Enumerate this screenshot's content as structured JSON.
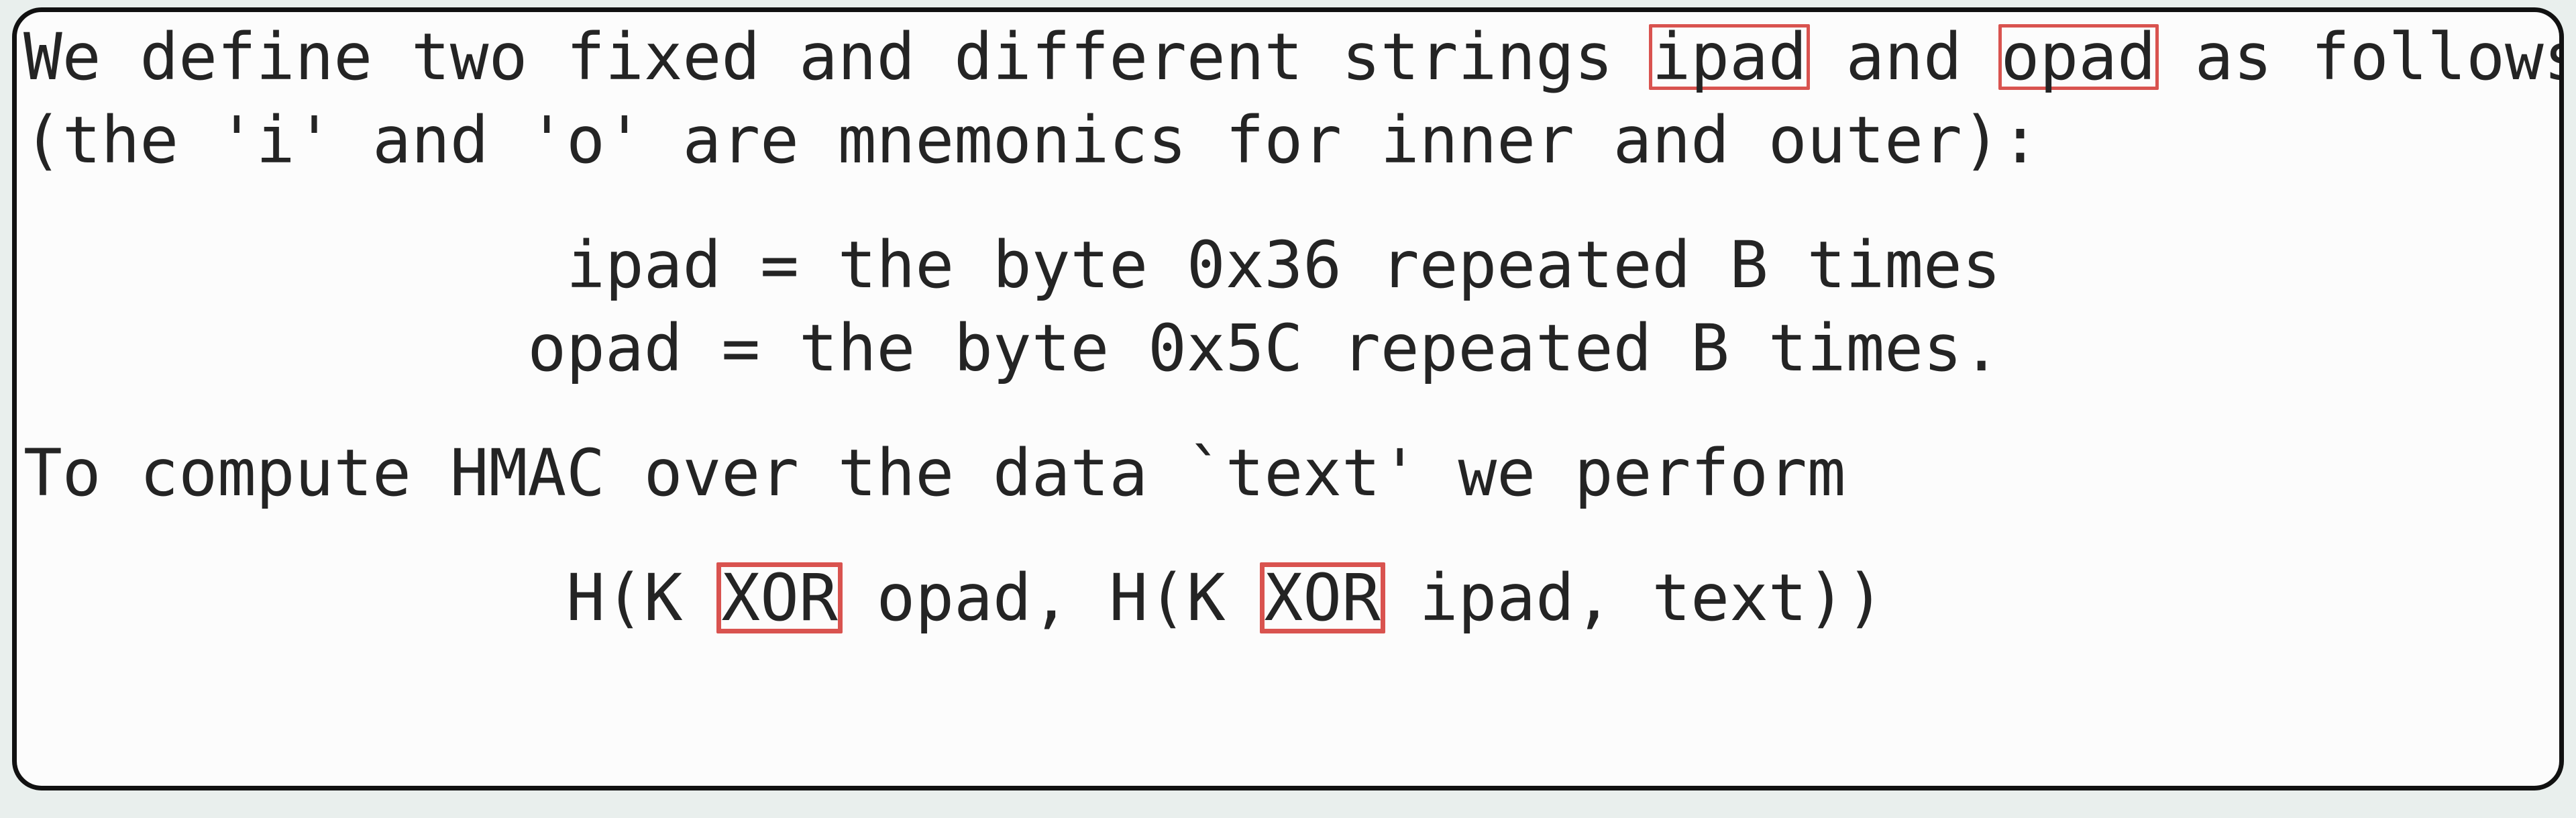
{
  "document": {
    "kind": "rfc-excerpt-card",
    "background_color": "#e9efed",
    "card_background_color": "#fcfcfc",
    "card_border_color": "#111111",
    "text_color": "#242424",
    "highlight_color": "#d9534f",
    "lines": [
      {
        "id": "line-1",
        "segments": [
          {
            "text": "We define two fixed and different strings "
          },
          {
            "text": "ipad",
            "highlighted": true
          },
          {
            "text": " and "
          },
          {
            "text": "opad",
            "highlighted": true
          },
          {
            "text": " as follows"
          }
        ]
      },
      {
        "id": "line-2",
        "segments": [
          {
            "text": "(the 'i' and 'o' are mnemonics for inner and outer):"
          }
        ]
      },
      {
        "id": "line-3-blank",
        "blank": true,
        "segments": []
      },
      {
        "id": "line-4",
        "segments": [
          {
            "text": "              ipad = the byte 0x36 repeated B times"
          }
        ]
      },
      {
        "id": "line-5",
        "segments": [
          {
            "text": "             opad = the byte 0x5C repeated B times."
          }
        ]
      },
      {
        "id": "line-6-blank",
        "blank": true,
        "segments": []
      },
      {
        "id": "line-7",
        "segments": [
          {
            "text": "To compute HMAC over the data `text' we perform"
          }
        ]
      },
      {
        "id": "line-8-blank",
        "blank": true,
        "segments": []
      },
      {
        "id": "line-9",
        "segments": [
          {
            "text": "              H(K "
          },
          {
            "text": "XOR",
            "highlighted": true,
            "thick": true
          },
          {
            "text": " opad, H(K "
          },
          {
            "text": "XOR",
            "highlighted": true,
            "thick": true
          },
          {
            "text": " ipad, text))"
          }
        ]
      }
    ],
    "highlighted_tokens": [
      "ipad",
      "opad",
      "XOR",
      "XOR"
    ],
    "constants": {
      "ipad_byte": "0x36",
      "opad_byte": "0x5C",
      "block_size_symbol": "B",
      "hmac_formula": "H(K XOR opad, H(K XOR ipad, text))"
    }
  }
}
